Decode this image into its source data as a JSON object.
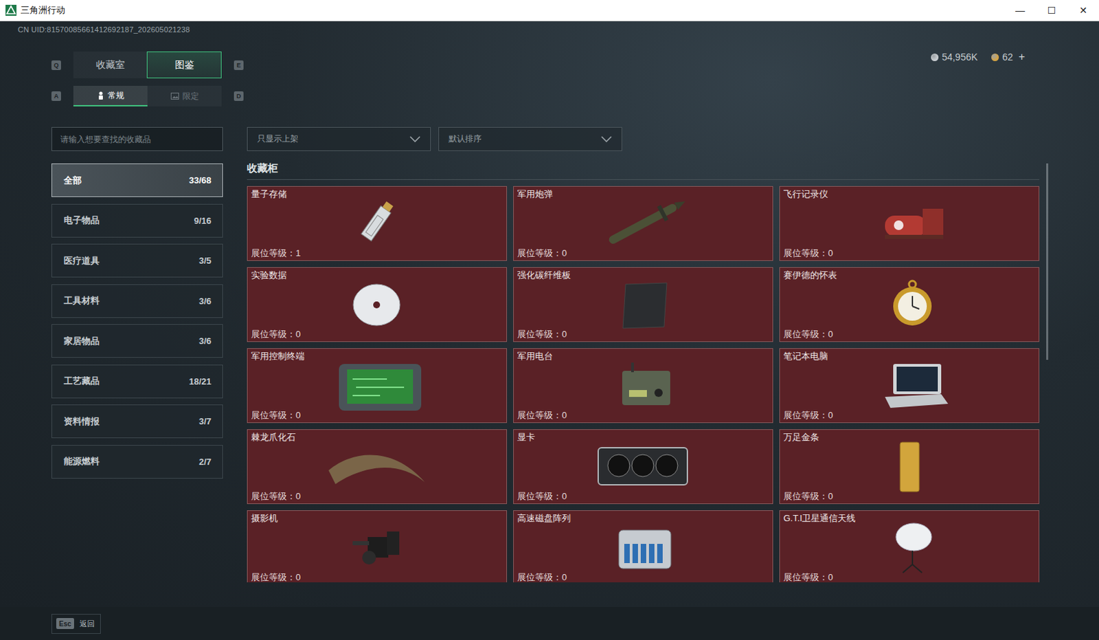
{
  "window": {
    "title": "三角洲行动",
    "controls": [
      "—",
      "☐",
      "✕"
    ]
  },
  "uid": "CN UID:81570085661412692187_202605021238",
  "currency": [
    {
      "value": "54,956K",
      "color": "#c9cdd1"
    },
    {
      "value": "62",
      "color": "#d6a443"
    }
  ],
  "currency_add": "+",
  "tabs": {
    "prev_key": "Q",
    "next_key": "E",
    "items": [
      {
        "label": "收藏室",
        "selected": false
      },
      {
        "label": "图鉴",
        "selected": true
      }
    ]
  },
  "subtabs": {
    "prev_key": "A",
    "next_key": "D",
    "items": [
      {
        "label": "常规",
        "selected": true,
        "kind": "person"
      },
      {
        "label": "限定",
        "selected": false,
        "kind": "image"
      }
    ]
  },
  "search": {
    "placeholder": "请输入想要查找的收藏品"
  },
  "filters": [
    {
      "label": "只显示上架"
    },
    {
      "label": "默认排序"
    }
  ],
  "sidebar": {
    "items": [
      {
        "label": "全部",
        "count": "33/68",
        "selected": true
      },
      {
        "label": "电子物品",
        "count": "9/16",
        "selected": false
      },
      {
        "label": "医疗道具",
        "count": "3/5",
        "selected": false
      },
      {
        "label": "工具材料",
        "count": "3/6",
        "selected": false
      },
      {
        "label": "家居物品",
        "count": "3/6",
        "selected": false
      },
      {
        "label": "工艺藏品",
        "count": "18/21",
        "selected": false
      },
      {
        "label": "资料情报",
        "count": "3/7",
        "selected": false
      },
      {
        "label": "能源燃料",
        "count": "2/7",
        "selected": false
      }
    ]
  },
  "section": {
    "title": "收藏柜",
    "grade_label": "展位等级："
  },
  "cards": [
    {
      "name": "量子存储",
      "grade": "1",
      "kind": "usb-drive"
    },
    {
      "name": "军用炮弹",
      "grade": "0",
      "kind": "shell"
    },
    {
      "name": "飞行记录仪",
      "grade": "0",
      "kind": "flight-recorder"
    },
    {
      "name": "实验数据",
      "grade": "0",
      "kind": "disc"
    },
    {
      "name": "强化碳纤维板",
      "grade": "0",
      "kind": "carbon-plate"
    },
    {
      "name": "赛伊德的怀表",
      "grade": "0",
      "kind": "pocket-watch"
    },
    {
      "name": "军用控制终端",
      "grade": "0",
      "kind": "terminal"
    },
    {
      "name": "军用电台",
      "grade": "0",
      "kind": "radio"
    },
    {
      "name": "笔记本电脑",
      "grade": "0",
      "kind": "laptop"
    },
    {
      "name": "棘龙爪化石",
      "grade": "0",
      "kind": "claw-fossil"
    },
    {
      "name": "显卡",
      "grade": "0",
      "kind": "gpu"
    },
    {
      "name": "万足金条",
      "grade": "0",
      "kind": "gold-bar"
    },
    {
      "name": "摄影机",
      "grade": "0",
      "kind": "camera"
    },
    {
      "name": "高速磁盘阵列",
      "grade": "0",
      "kind": "disk-array"
    },
    {
      "name": "G.T.I卫星通信天线",
      "grade": "0",
      "kind": "satellite-dish"
    }
  ],
  "scrollbar": {
    "level": 0.47
  },
  "footer": {
    "key": "Esc",
    "label": "返回"
  }
}
